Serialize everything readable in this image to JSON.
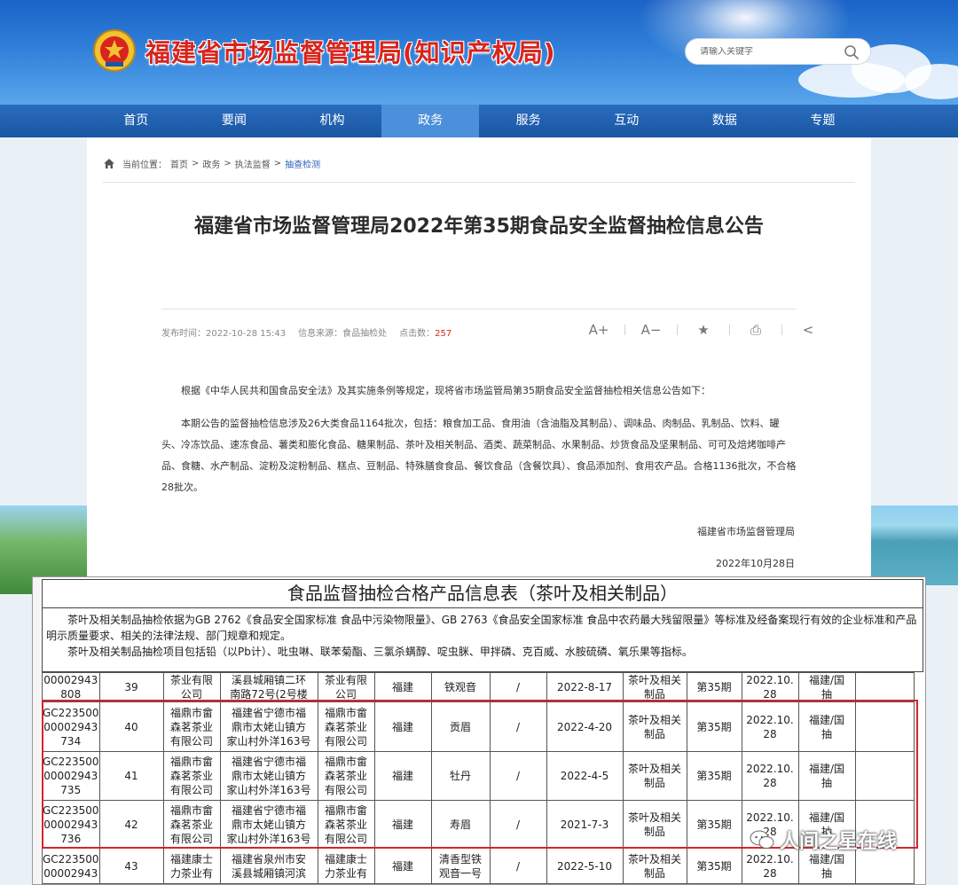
{
  "site": {
    "title": "福建省市场监督管理局(知识产权局)",
    "search_placeholder": "请输入关键字"
  },
  "nav": [
    "首页",
    "要闻",
    "机构",
    "政务",
    "服务",
    "互动",
    "数据",
    "专题"
  ],
  "nav_active": "政务",
  "breadcrumb": {
    "prefix": "当前位置：",
    "items": [
      "首页",
      "政务",
      "执法监督"
    ],
    "current": "抽查检测",
    "sep": ">"
  },
  "article": {
    "title": "福建省市场监督管理局2022年第35期食品安全监督抽检信息公告",
    "publish_label": "发布时间：2022-10-28 15:43",
    "source_label": "信息来源：食品抽检处",
    "clicks_label": "点击数：",
    "clicks": "257",
    "tools": [
      "A+",
      "A−",
      "★",
      "⎙",
      "<"
    ],
    "para1": "根据《中华人民共和国食品安全法》及其实施条例等规定，现将省市场监管局第35期食品安全监督抽检相关信息公告如下：",
    "para2": "本期公告的监督抽检信息涉及26大类食品1164批次，包括：粮食加工品、食用油（含油脂及其制品）、调味品、肉制品、乳制品、饮料、罐头、冷冻饮品、速冻食品、薯类和膨化食品、糖果制品、茶叶及相关制品、酒类、蔬菜制品、水果制品、炒货食品及坚果制品、可可及焙烤咖啡产品、食糖、水产制品、淀粉及淀粉制品、糕点、豆制品、特殊膳食食品、餐饮食品（含餐饮具）、食品添加剂、食用农产品。合格1136批次，不合格28批次。",
    "signature": "福建省市场监督管理局",
    "date": "2022年10月28日"
  },
  "sheet": {
    "title": "食品监督抽检合格产品信息表（茶叶及相关制品）",
    "desc1": "茶叶及相关制品抽检依据为GB 2762《食品安全国家标准 食品中污染物限量》、GB 2763《食品安全国家标准 食品中农药最大残留限量》等标准及经备案现行有效的企业标准和产品明示质量要求、相关的法律法规、部门规章和规定。",
    "desc2": "茶叶及相关制品抽检项目包括铅（以Pb计）、吡虫啉、联苯菊酯、三氯杀螨醇、啶虫脒、甲拌磷、克百威、水胺硫磷、氧乐果等指标。",
    "rows": [
      [
        "00002943\n808",
        "39",
        "茶业有限\n公司",
        "溪县城厢镇二环\n南路72号(2号楼",
        "茶业有限\n公司",
        "福建",
        "铁观音",
        "/",
        "2022-8-17",
        "茶叶及相关\n制品",
        "第35期",
        "2022.10.\n28",
        "福建/国\n抽"
      ],
      [
        "GC223500\n00002943\n734",
        "40",
        "福鼎市畲\n森茗茶业\n有限公司",
        "福建省宁德市福\n鼎市太姥山镇方\n家山村外洋163号",
        "福鼎市畲\n森茗茶业\n有限公司",
        "福建",
        "贡眉",
        "/",
        "2022-4-20",
        "茶叶及相关\n制品",
        "第35期",
        "2022.10.\n28",
        "福建/国\n抽"
      ],
      [
        "GC223500\n00002943\n735",
        "41",
        "福鼎市畲\n森茗茶业\n有限公司",
        "福建省宁德市福\n鼎市太姥山镇方\n家山村外洋163号",
        "福鼎市畲\n森茗茶业\n有限公司",
        "福建",
        "牡丹",
        "/",
        "2022-4-5",
        "茶叶及相关\n制品",
        "第35期",
        "2022.10.\n28",
        "福建/国\n抽"
      ],
      [
        "GC223500\n00002943\n736",
        "42",
        "福鼎市畲\n森茗茶业\n有限公司",
        "福建省宁德市福\n鼎市太姥山镇方\n家山村外洋163号",
        "福鼎市畲\n森茗茶业\n有限公司",
        "福建",
        "寿眉",
        "/",
        "2021-7-3",
        "茶叶及相关\n制品",
        "第35期",
        "2022.10.\n28",
        "福建/国\n抽"
      ],
      [
        "GC223500\n00002943",
        "43",
        "福建康士\n力茶业有",
        "福建省泉州市安\n溪县城厢镇河滨",
        "福建康士\n力茶业有",
        "福建",
        "清香型铁\n观音一号",
        "/",
        "2022-5-10",
        "茶叶及相关\n制品",
        "第35期",
        "2022.10.\n28",
        "福建/国\n抽"
      ]
    ]
  },
  "watermark": "人间之星在线",
  "colors": {
    "brand_red": "#d8241c",
    "nav_blue": "#1a56a3",
    "highlight_red": "#d9222a"
  }
}
